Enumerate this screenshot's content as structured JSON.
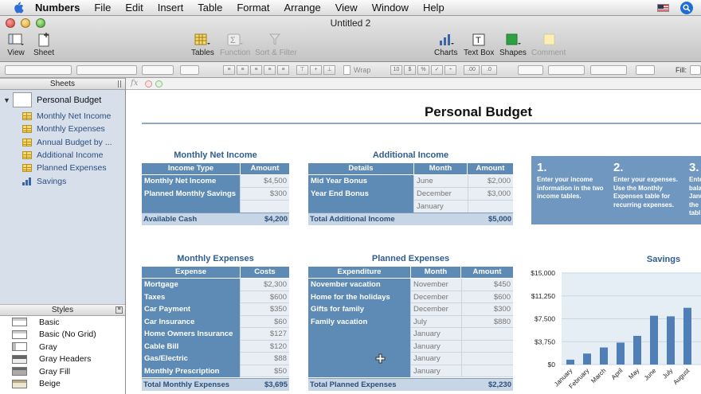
{
  "menubar": {
    "app": "Numbers",
    "items": [
      "File",
      "Edit",
      "Insert",
      "Table",
      "Format",
      "Arrange",
      "View",
      "Window",
      "Help"
    ]
  },
  "window": {
    "title": "Untitled 2"
  },
  "toolbar": {
    "view": "View",
    "sheet": "Sheet",
    "tables": "Tables",
    "function": "Function",
    "sort_filter": "Sort & Filter",
    "charts": "Charts",
    "text_box": "Text Box",
    "shapes": "Shapes",
    "comment": "Comment"
  },
  "formatbar": {
    "wrap": "Wrap",
    "fill": "Fill:"
  },
  "fxbar": {
    "fx": "fx"
  },
  "sidebar": {
    "sheets_header": "Sheets",
    "sheet_name": "Personal Budget",
    "tables": [
      {
        "label": "Monthly Net Income",
        "icon": "table-icon"
      },
      {
        "label": "Monthly Expenses",
        "icon": "table-icon"
      },
      {
        "label": "Annual Budget by ...",
        "icon": "table-icon"
      },
      {
        "label": "Additional Income",
        "icon": "table-icon"
      },
      {
        "label": "Planned Expenses",
        "icon": "table-icon"
      },
      {
        "label": "Savings",
        "icon": "chart-icon"
      }
    ],
    "styles_header": "Styles",
    "styles": [
      "Basic",
      "Basic (No Grid)",
      "Gray",
      "Gray Headers",
      "Gray Fill",
      "Beige"
    ]
  },
  "doc": {
    "title": "Personal Budget",
    "net_income": {
      "title": "Monthly Net Income",
      "headers": [
        "Income Type",
        "Amount"
      ],
      "rows": [
        [
          "Monthly Net Income",
          "$4,500"
        ],
        [
          "Planned Monthly Savings",
          "$300"
        ],
        [
          "",
          ""
        ]
      ],
      "footer": [
        "Available Cash",
        "$4,200"
      ]
    },
    "additional_income": {
      "title": "Additional Income",
      "headers": [
        "Details",
        "Month",
        "Amount"
      ],
      "rows": [
        [
          "Mid Year Bonus",
          "June",
          "$2,000"
        ],
        [
          "Year End Bonus",
          "December",
          "$3,000"
        ],
        [
          "",
          "January",
          ""
        ]
      ],
      "footer": [
        "Total Additional Income",
        "$5,000"
      ]
    },
    "instructions": [
      {
        "n": "1.",
        "text": "Enter your income information in the two income tables."
      },
      {
        "n": "2.",
        "text": "Enter your expenses. Use the Monthly Expenses table for recurring expenses."
      },
      {
        "n": "3.",
        "text": "Ente bala Janu the tabl"
      }
    ],
    "monthly_expenses": {
      "title": "Monthly Expenses",
      "headers": [
        "Expense",
        "Costs"
      ],
      "rows": [
        [
          "Mortgage",
          "$2,300"
        ],
        [
          "Taxes",
          "$600"
        ],
        [
          "Car Payment",
          "$350"
        ],
        [
          "Car Insurance",
          "$60"
        ],
        [
          "Home Owners Insurance",
          "$127"
        ],
        [
          "Cable Bill",
          "$120"
        ],
        [
          "Gas/Electric",
          "$88"
        ],
        [
          "Monthly Prescription",
          "$50"
        ]
      ],
      "footer": [
        "Total Monthly Expenses",
        "$3,695"
      ]
    },
    "planned_expenses": {
      "title": "Planned Expenses",
      "headers": [
        "Expenditure",
        "Month",
        "Amount"
      ],
      "rows": [
        [
          "November vacation",
          "November",
          "$450"
        ],
        [
          "Home for the holidays",
          "December",
          "$600"
        ],
        [
          "Gifts for family",
          "December",
          "$300"
        ],
        [
          "Family vacation",
          "July",
          "$880"
        ],
        [
          "",
          "January",
          ""
        ],
        [
          "",
          "January",
          ""
        ],
        [
          "",
          "January",
          ""
        ],
        [
          "",
          "January",
          ""
        ]
      ],
      "footer": [
        "Total Planned Expenses",
        "$2,230"
      ]
    }
  },
  "colors": {
    "header": "#5d8bb6",
    "accent": "#2f5d8f",
    "bar": "#4f7fb6"
  },
  "chart_data": {
    "type": "bar",
    "title": "Savings",
    "categories": [
      "January",
      "February",
      "March",
      "April",
      "May",
      "June",
      "July",
      "August"
    ],
    "values": [
      800,
      1800,
      2800,
      3600,
      4700,
      8000,
      7900,
      9300
    ],
    "ylim": [
      0,
      15000
    ],
    "yticks": [
      "$0",
      "$3,750",
      "$7,500",
      "$11,250",
      "$15,000"
    ],
    "xlabel": "",
    "ylabel": ""
  }
}
